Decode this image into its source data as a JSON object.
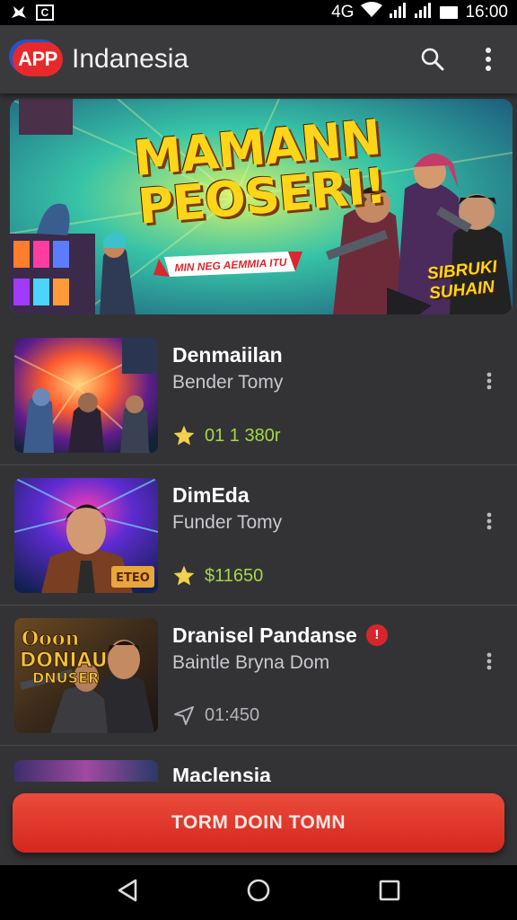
{
  "status_bar": {
    "network_label": "4G",
    "time": "16:00"
  },
  "app_bar": {
    "logo_text": "APP",
    "title": "Indanesia"
  },
  "banner": {
    "title_line1": "MAMANN",
    "title_line2": "PEOSERI!",
    "ribbon_text": "MIN NEG AEMMIA ITU",
    "side_line1": "SIBRUKI",
    "side_line2": "SUHAIN"
  },
  "items": [
    {
      "title": "Denmaiilan",
      "subtitle": "Bender Tomy",
      "meta_icon": "star-icon",
      "meta_value": "01 1 380r",
      "meta_color": "#a6d64a",
      "badge": ""
    },
    {
      "title": "DimEda",
      "subtitle": "Funder Tomy",
      "meta_icon": "star-icon",
      "meta_value": "$11650",
      "meta_color": "#a6d64a",
      "badge": ""
    },
    {
      "title": "Dranisel Pandanse",
      "subtitle": "Baintle Bryna Dom",
      "meta_icon": "send-icon",
      "meta_value": "01:450",
      "meta_color": "#b4b4b8",
      "badge": "!"
    },
    {
      "title": "Maclensia"
    }
  ],
  "thumb_texts": {
    "item2_logo": "ETEO",
    "item3_line1": "Ooon",
    "item3_line2": "DONIAU",
    "item3_line3": "DNUSER"
  },
  "cta": {
    "label": "TORM DOIN TOMN"
  },
  "colors": {
    "accent": "#e0362a",
    "background": "#333336",
    "star": "#f2d14c",
    "price_green": "#a6d64a"
  }
}
